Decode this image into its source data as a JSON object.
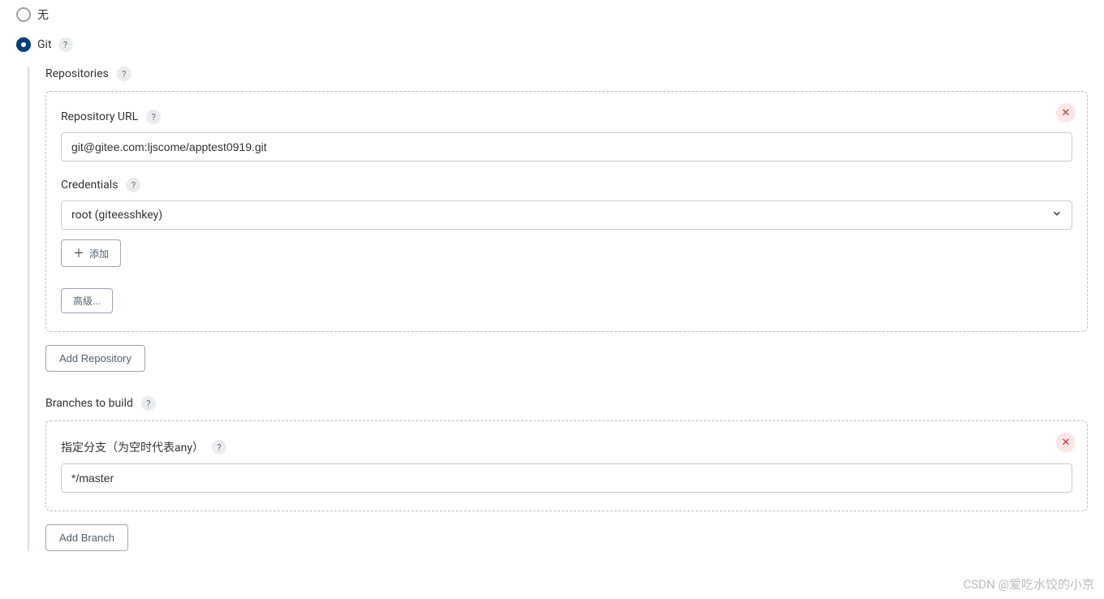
{
  "scm": {
    "none_label": "无",
    "git_label": "Git"
  },
  "repositories": {
    "title": "Repositories",
    "url_label": "Repository URL",
    "url_value": "git@gitee.com:ljscome/apptest0919.git",
    "credentials_label": "Credentials",
    "credentials_value": "root (giteesshkey)",
    "add_btn": "添加",
    "advanced_btn": "高级...",
    "add_repo_btn": "Add Repository"
  },
  "branches": {
    "title": "Branches to build",
    "specifier_label": "指定分支（为空时代表any）",
    "specifier_value": "*/master",
    "add_branch_btn": "Add Branch"
  },
  "watermark": "CSDN @爱吃水饺的小京",
  "help_q": "?",
  "close_x": "✕"
}
